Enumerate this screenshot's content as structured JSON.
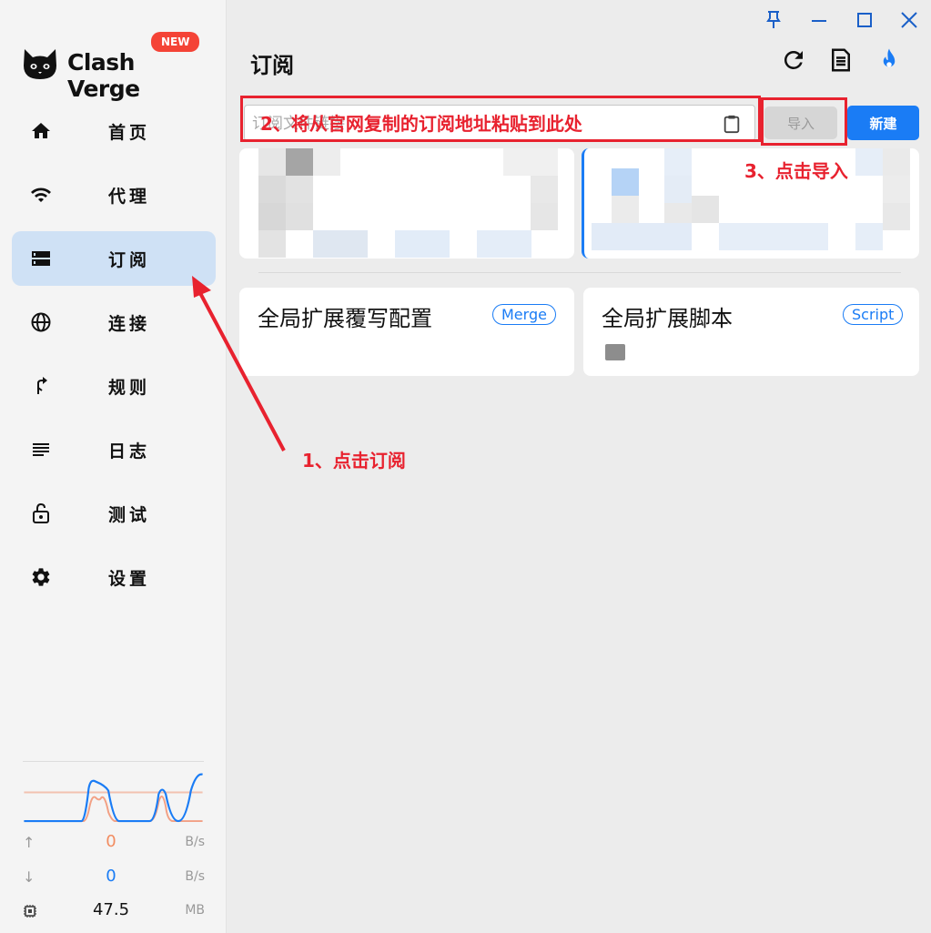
{
  "app": {
    "name": "Clash Verge",
    "new_badge": "NEW"
  },
  "sidebar": {
    "items": [
      {
        "label": "首页",
        "icon": "home-icon",
        "active": false
      },
      {
        "label": "代理",
        "icon": "wifi-icon",
        "active": false
      },
      {
        "label": "订阅",
        "icon": "storage-icon",
        "active": true
      },
      {
        "label": "连接",
        "icon": "globe-icon",
        "active": false
      },
      {
        "label": "规则",
        "icon": "fork-icon",
        "active": false
      },
      {
        "label": "日志",
        "icon": "list-icon",
        "active": false
      },
      {
        "label": "测试",
        "icon": "lock-icon",
        "active": false
      },
      {
        "label": "设置",
        "icon": "gear-icon",
        "active": false
      }
    ],
    "traffic": {
      "upload": {
        "value": "0",
        "unit": "B/s",
        "color": "#f28c60"
      },
      "download": {
        "value": "0",
        "unit": "B/s",
        "color": "#1a7cf5"
      },
      "memory": {
        "value": "47.5",
        "unit": "MB"
      }
    }
  },
  "header": {
    "title": "订阅"
  },
  "import_bar": {
    "placeholder": "订阅文件链接",
    "import_label": "导入",
    "new_label": "新建"
  },
  "extensions": [
    {
      "title": "全局扩展覆写配置",
      "badge": "Merge"
    },
    {
      "title": "全局扩展脚本",
      "badge": "Script"
    }
  ],
  "annotations": {
    "step1": "1、点击订阅",
    "step2": "2、将从官网复制的订阅地址粘贴到此处",
    "step3": "3、点击导入",
    "color": "#e8222f"
  },
  "colors": {
    "accent": "#1a7cf5",
    "active_nav": "#cfe1f5"
  }
}
